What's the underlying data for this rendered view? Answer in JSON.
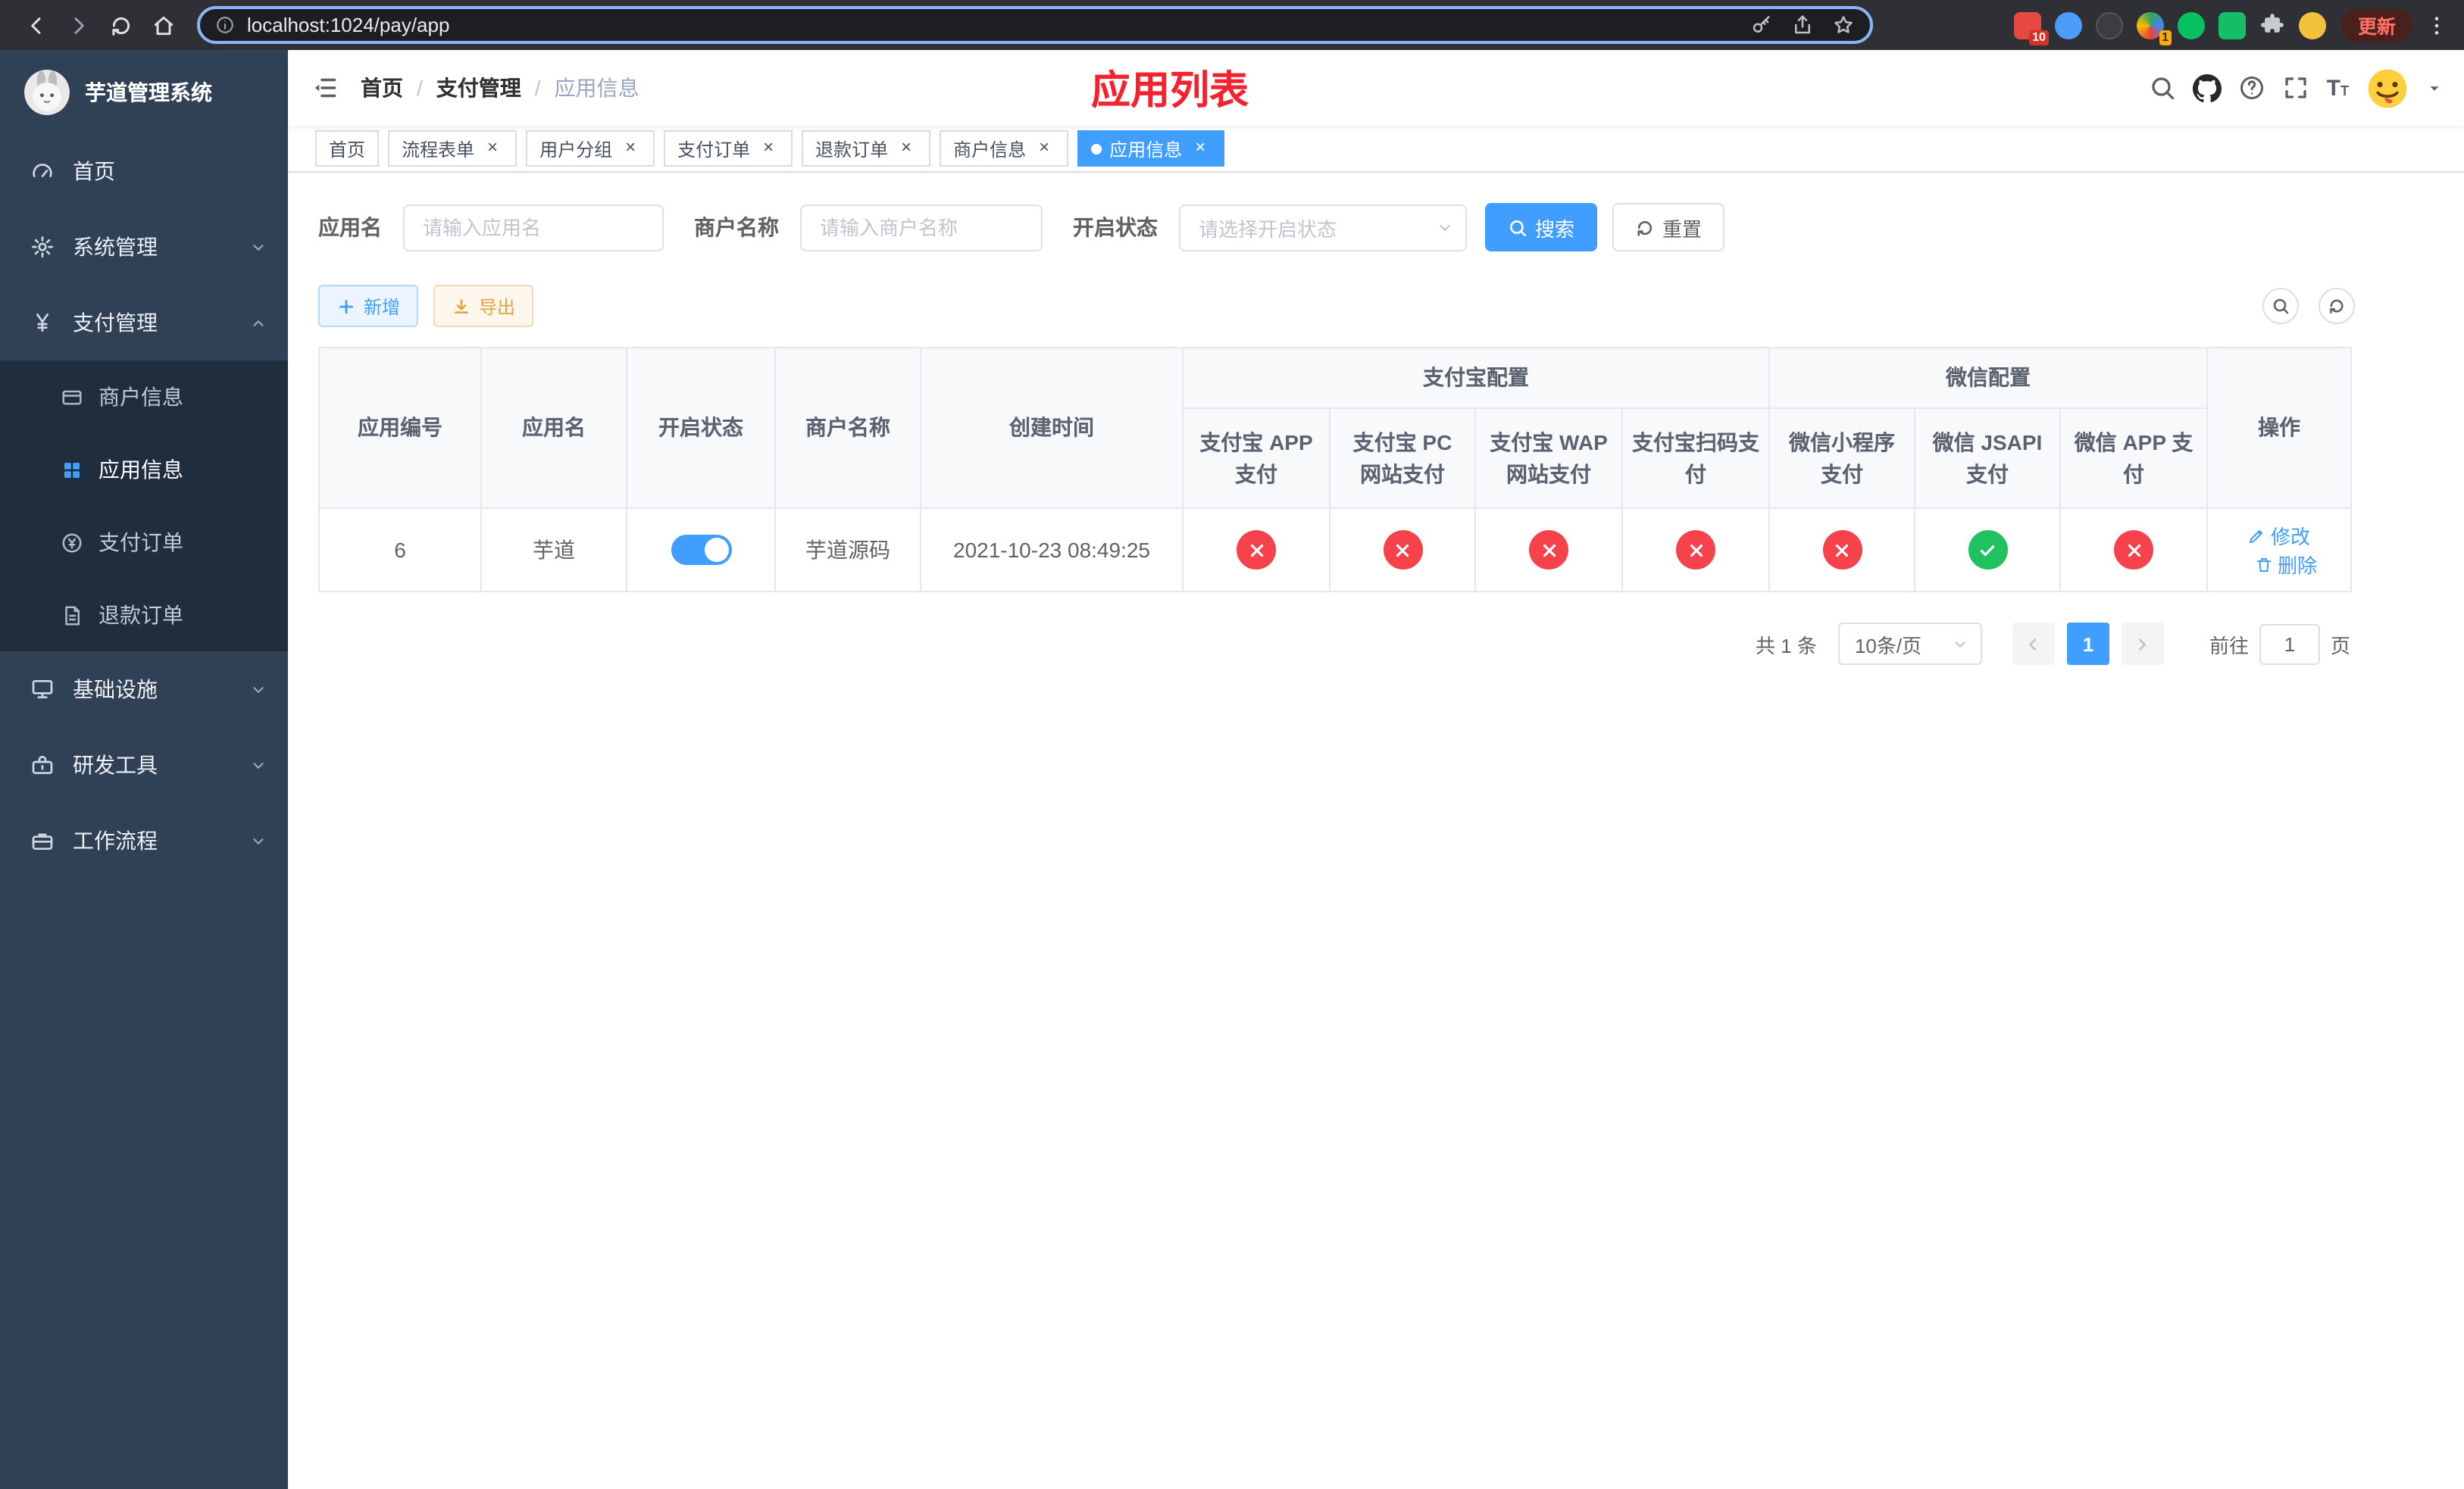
{
  "colors": {
    "accent": "#409EFF",
    "danger_circle": "#f5424b",
    "success_circle": "#1fc25f",
    "title_red": "#f5222d",
    "sidebar_bg": "#304156",
    "submenu_bg": "#1f2d3d"
  },
  "browser": {
    "url": "localhost:1024/pay/app",
    "update_label": "更新",
    "ext_badge_red": "10",
    "ext_badge_yellow": "1"
  },
  "sidebar": {
    "title": "芋道管理系统",
    "items": [
      {
        "label": "首页"
      },
      {
        "label": "系统管理"
      },
      {
        "label": "支付管理"
      },
      {
        "label": "基础设施"
      },
      {
        "label": "研发工具"
      },
      {
        "label": "工作流程"
      }
    ],
    "submenu": [
      {
        "label": "商户信息"
      },
      {
        "label": "应用信息"
      },
      {
        "label": "支付订单"
      },
      {
        "label": "退款订单"
      }
    ]
  },
  "breadcrumb": {
    "home": "首页",
    "section": "支付管理",
    "current": "应用信息"
  },
  "page_title": "应用列表",
  "tabs": [
    {
      "label": "首页"
    },
    {
      "label": "流程表单"
    },
    {
      "label": "用户分组"
    },
    {
      "label": "支付订单"
    },
    {
      "label": "退款订单"
    },
    {
      "label": "商户信息"
    },
    {
      "label": "应用信息"
    }
  ],
  "filters": {
    "app_name_label": "应用名",
    "app_name_placeholder": "请输入应用名",
    "merchant_label": "商户名称",
    "merchant_placeholder": "请输入商户名称",
    "status_label": "开启状态",
    "status_placeholder": "请选择开启状态",
    "search_label": "搜索",
    "reset_label": "重置"
  },
  "toolbar": {
    "add_label": "新增",
    "export_label": "导出"
  },
  "table": {
    "headers": {
      "app_id": "应用编号",
      "app_name": "应用名",
      "status": "开启状态",
      "merchant": "商户名称",
      "created": "创建时间",
      "alipay_group": "支付宝配置",
      "wechat_group": "微信配置",
      "alipay_app": "支付宝 APP 支付",
      "alipay_pc": "支付宝 PC 网站支付",
      "alipay_wap": "支付宝 WAP 网站支付",
      "alipay_scan": "支付宝扫码支付",
      "wx_mini": "微信小程序支付",
      "wx_jsapi": "微信 JSAPI 支付",
      "wx_app": "微信 APP 支付",
      "actions": "操作"
    },
    "row": {
      "app_id": "6",
      "app_name": "芋道",
      "status_on": true,
      "merchant": "芋道源码",
      "created": "2021-10-23 08:49:25",
      "alipay_app": "no",
      "alipay_pc": "no",
      "alipay_wap": "no",
      "alipay_scan": "no",
      "wx_mini": "no",
      "wx_jsapi": "yes",
      "wx_app": "no",
      "edit_label": "修改",
      "delete_label": "删除"
    }
  },
  "pagination": {
    "total_text": "共 1 条",
    "page_size": "10条/页",
    "current_page": "1",
    "goto_label": "前往",
    "goto_value": "1",
    "page_unit": "页"
  }
}
